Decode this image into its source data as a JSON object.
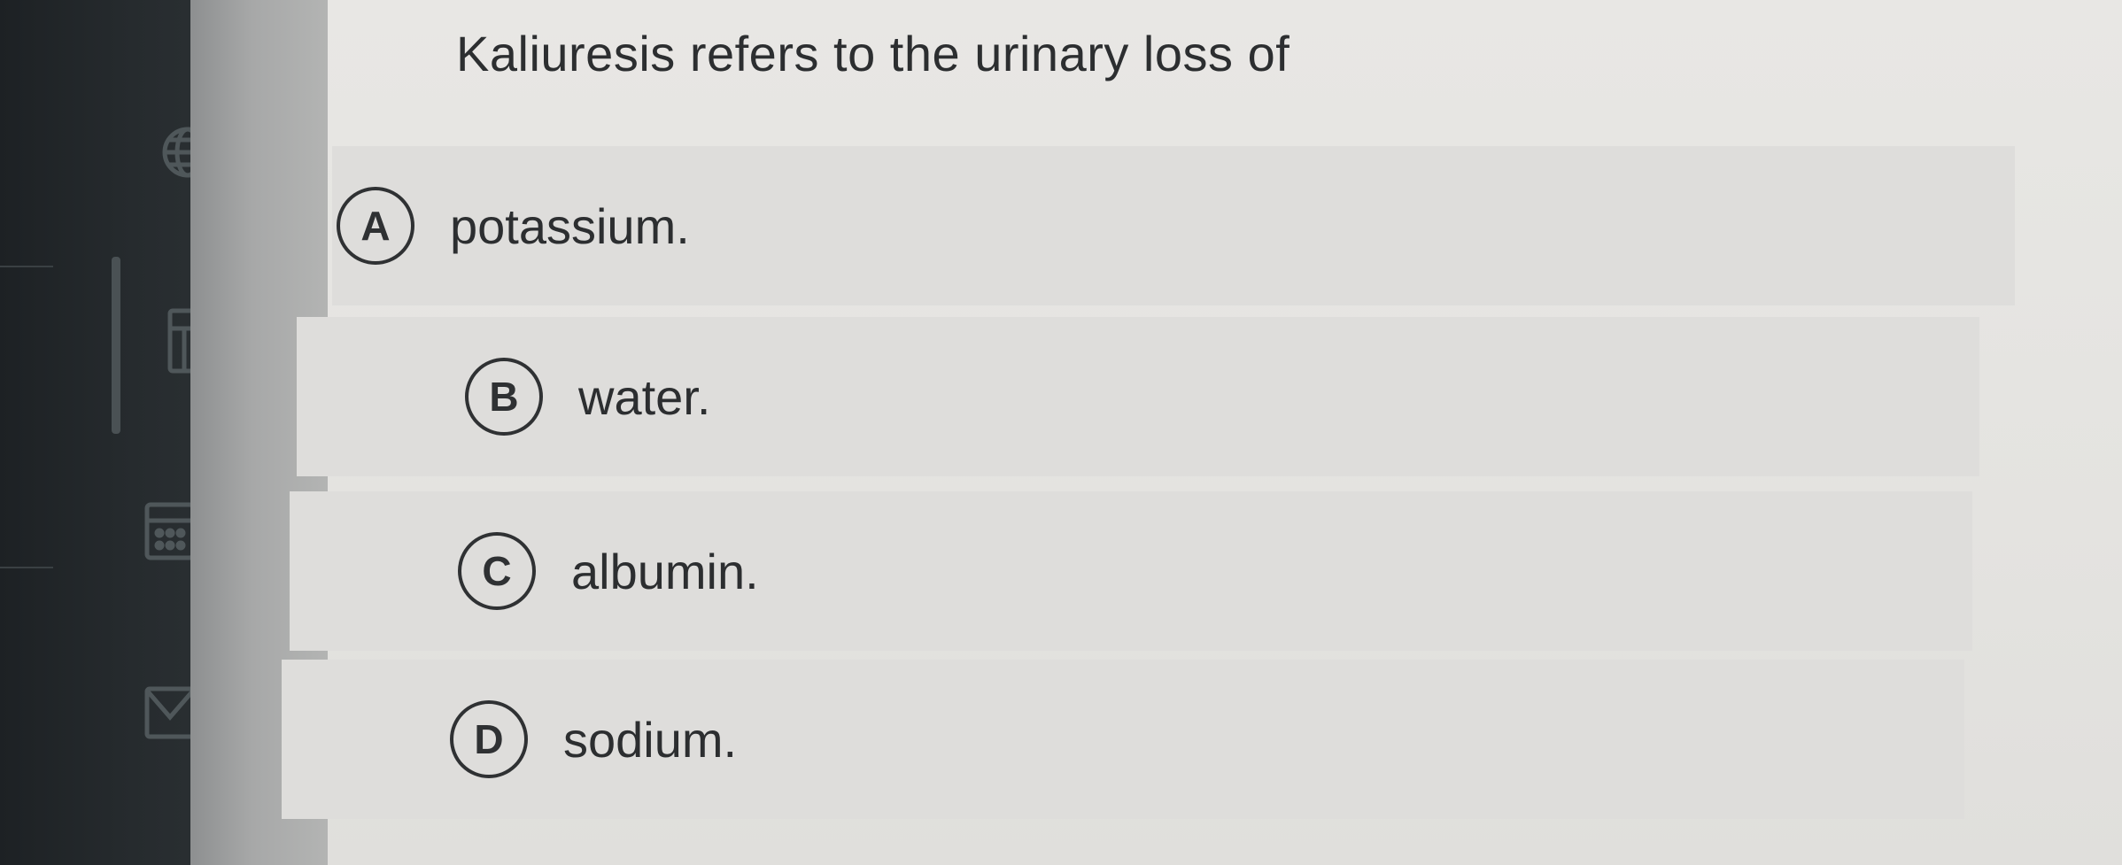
{
  "question": {
    "text": "Kaliuresis refers to the urinary loss of"
  },
  "options": [
    {
      "letter": "A",
      "text": "potassium."
    },
    {
      "letter": "B",
      "text": "water."
    },
    {
      "letter": "C",
      "text": "albumin."
    },
    {
      "letter": "D",
      "text": "sodium."
    }
  ],
  "sidebar": {
    "icons": [
      "globe-icon",
      "grades-icon",
      "calendar-icon",
      "mail-icon"
    ]
  }
}
